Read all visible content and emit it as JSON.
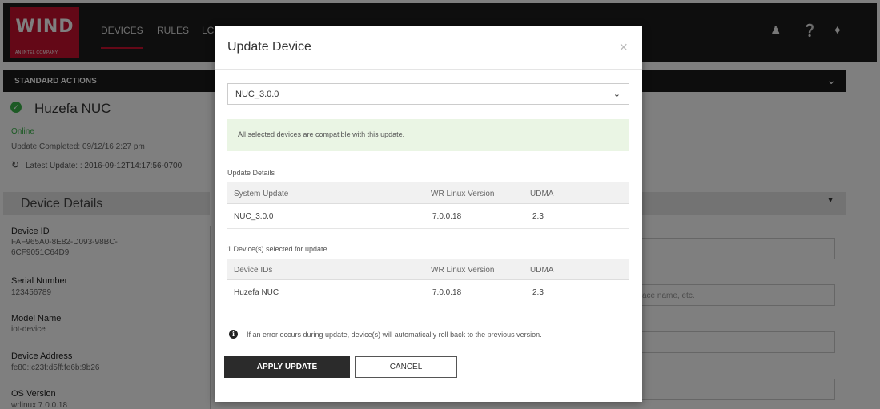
{
  "header": {
    "logo_word": "WIND",
    "logo_sub": "AN INTEL COMPANY",
    "nav": [
      {
        "label": "DEVICES",
        "active": true
      },
      {
        "label": "RULES",
        "active": false
      },
      {
        "label": "LC",
        "active": false
      }
    ],
    "icons": [
      "user-icon",
      "help-icon",
      "bell-icon"
    ]
  },
  "standard_actions": {
    "label": "STANDARD ACTIONS"
  },
  "device": {
    "name": "Huzefa NUC",
    "status": "Online",
    "update_completed": "Update Completed: 09/12/16 2:27 pm",
    "latest_update": "Latest Update: : 2016-09-12T14:17:56-0700"
  },
  "device_details": {
    "title": "Device Details",
    "fields": [
      {
        "label": "Device ID",
        "value": "FAF965A0-8E82-D093-98BC-6CF9051C64D9"
      },
      {
        "label": "Serial Number",
        "value": "123456789"
      },
      {
        "label": "Model Name",
        "value": "iot-device"
      },
      {
        "label": "Device Address",
        "value": "fe80::c23f:d5ff:fe6b:9b26"
      },
      {
        "label": "OS Version",
        "value": "wrlinux 7.0.0.18"
      }
    ]
  },
  "right_panel": {
    "placeholder": "ace name, etc."
  },
  "modal": {
    "title": "Update Device",
    "close": "×",
    "selected_update": "NUC_3.0.0",
    "compat_message": "All selected devices are compatible with this update.",
    "update_details": {
      "label": "Update Details",
      "headers": [
        "System Update",
        "WR Linux Version",
        "UDMA"
      ],
      "rows": [
        [
          "NUC_3.0.0",
          "7.0.0.18",
          "2.3"
        ]
      ]
    },
    "devices_selected": {
      "label": "1 Device(s) selected for update",
      "headers": [
        "Device IDs",
        "WR Linux Version",
        "UDMA"
      ],
      "rows": [
        [
          "Huzefa NUC",
          "7.0.0.18",
          "2.3"
        ]
      ]
    },
    "info_text": "If an error occurs during update, device(s) will automatically roll back to the previous version.",
    "apply_label": "APPLY UPDATE",
    "cancel_label": "CANCEL"
  },
  "colors": {
    "brand_red": "#c8102e",
    "online_green": "#3bb54a",
    "compat_bg": "#eaf5e4"
  }
}
